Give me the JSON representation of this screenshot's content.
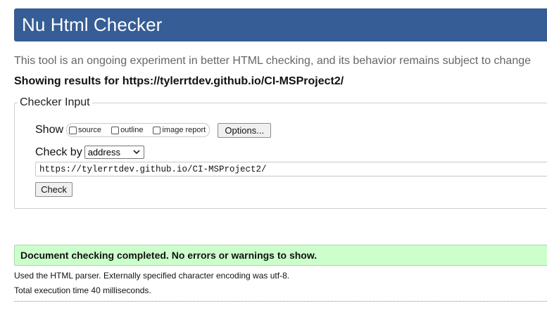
{
  "header": {
    "title": "Nu Html Checker"
  },
  "tagline": "This tool is an ongoing experiment in better HTML checking, and its behavior remains subject to change",
  "results_for": "Showing results for https://tylerrtdev.github.io/CI-MSProject2/",
  "checker_input": {
    "legend": "Checker Input",
    "show_label": "Show",
    "show_options": [
      {
        "label": "source",
        "checked": false
      },
      {
        "label": "outline",
        "checked": false
      },
      {
        "label": "image report",
        "checked": false
      }
    ],
    "options_button": "Options...",
    "check_by_label": "Check by",
    "check_by_value": "address",
    "url_value": "https://tylerrtdev.github.io/CI-MSProject2/",
    "check_button": "Check"
  },
  "result": {
    "success_message": "Document checking completed. No errors or warnings to show.",
    "parser_info": "Used the HTML parser. Externally specified character encoding was utf-8.",
    "execution_time": "Total execution time 40 milliseconds."
  },
  "colors": {
    "header_bg": "#365d95",
    "success_bg": "#ccffcc"
  }
}
